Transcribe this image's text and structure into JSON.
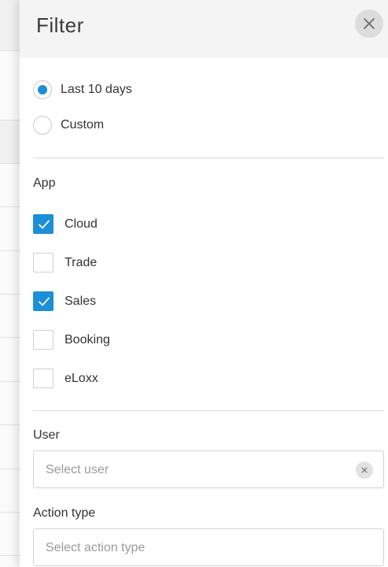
{
  "drawer": {
    "title": "Filter",
    "close_icon": "close-icon"
  },
  "date_range": {
    "options": [
      {
        "label": "Last 10 days",
        "selected": true
      },
      {
        "label": "Custom",
        "selected": false
      }
    ]
  },
  "app_section": {
    "label": "App",
    "items": [
      {
        "label": "Cloud",
        "checked": true
      },
      {
        "label": "Trade",
        "checked": false
      },
      {
        "label": "Sales",
        "checked": true
      },
      {
        "label": "Booking",
        "checked": false
      },
      {
        "label": "eLoxx",
        "checked": false
      }
    ]
  },
  "user_section": {
    "label": "User",
    "placeholder": "Select user",
    "clear_icon": "clear-icon"
  },
  "action_section": {
    "label": "Action type",
    "placeholder": "Select action type"
  },
  "colors": {
    "accent": "#1c8fd6",
    "header_bg": "#f4f4f4"
  }
}
